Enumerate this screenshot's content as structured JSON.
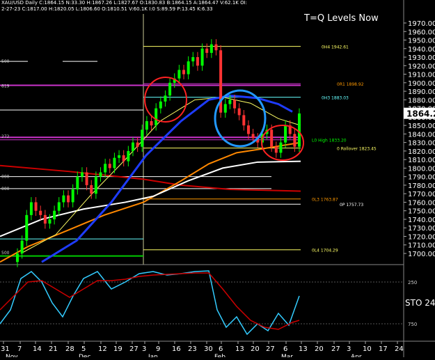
{
  "header": {
    "line1": "XAU/USD Daily C:1864.15 N:33.30 H:1867.26 L:1827.67 O:1830.83 B:1864.15 A:1864.47 V:62.1K OI:",
    "line2": "2-27-23 C:1817.00 H:1820.05 L:1806.60 O:1810.51 V:60.1K I:0 S:89.59 P:13.45 K:6.33"
  },
  "title_overlay": "T=Q Levels Now",
  "current_price": "1864.21",
  "price_axis": [
    "1970.00",
    "1960.00",
    "1950.00",
    "1940.00",
    "1930.00",
    "1920.00",
    "1910.00",
    "1900.00",
    "1890.00",
    "1880.00",
    "1870.00",
    "1860.00",
    "1850.00",
    "1840.00",
    "1830.00",
    "1820.00",
    "1810.00",
    "1800.00",
    "1790.00",
    "1780.00",
    "1770.00",
    "1760.00",
    "1750.00",
    "1740.00",
    "1730.00",
    "1720.00",
    "1710.00",
    "1700.00"
  ],
  "stoch_axis": {
    "upper": "250",
    "label": "STO 24,",
    "lower": "750"
  },
  "levels": [
    {
      "label": "0H4 1942.61",
      "price": 1942.61,
      "color": "#ffff66"
    },
    {
      "label": "0R1 1898.92",
      "price": 1898.92,
      "color": "#ff9900"
    },
    {
      "label": "0H3 1883.03",
      "price": 1883.03,
      "color": "#66ffff"
    },
    {
      "label": "L0 High 1833.20",
      "price": 1833.2,
      "color": "#00ff00"
    },
    {
      "label": "0 Rollover 1823.45",
      "price": 1823.45,
      "color": "#ffff66"
    },
    {
      "label": "0L3 1763.87",
      "price": 1763.87,
      "color": "#ff9900"
    },
    {
      "label": "0P 1757.73",
      "price": 1757.73,
      "color": "#ffffff"
    },
    {
      "label": "0L4 1704.29",
      "price": 1704.29,
      "color": "#ffff66"
    }
  ],
  "left_labels": [
    "500",
    "819",
    "272",
    "000",
    "000",
    "500"
  ],
  "x_axis": {
    "days": [
      "31",
      "7",
      "14",
      "21",
      "28",
      "5",
      "12",
      "19",
      "27",
      "3",
      "9",
      "16",
      "23",
      "30",
      "6",
      "13",
      "20",
      "27",
      "6",
      "13",
      "20",
      "27",
      "3",
      "10",
      "17",
      "24"
    ],
    "months": [
      "Nov",
      "Dec",
      "Jan",
      "Feb",
      "Mar",
      "Apr"
    ]
  },
  "colors": {
    "up": "#00ff00",
    "down": "#ff3333",
    "ma_blue": "#1e3cff",
    "ma_yellow": "#ffff66",
    "ma_orange": "#ff8800",
    "ma_white": "#ffffff",
    "ma_red": "#cc0000",
    "sto_cyan": "#33ccff",
    "sto_red": "#cc0000",
    "circle_red": "#ff2222",
    "circle_blue": "#2299ff"
  }
}
